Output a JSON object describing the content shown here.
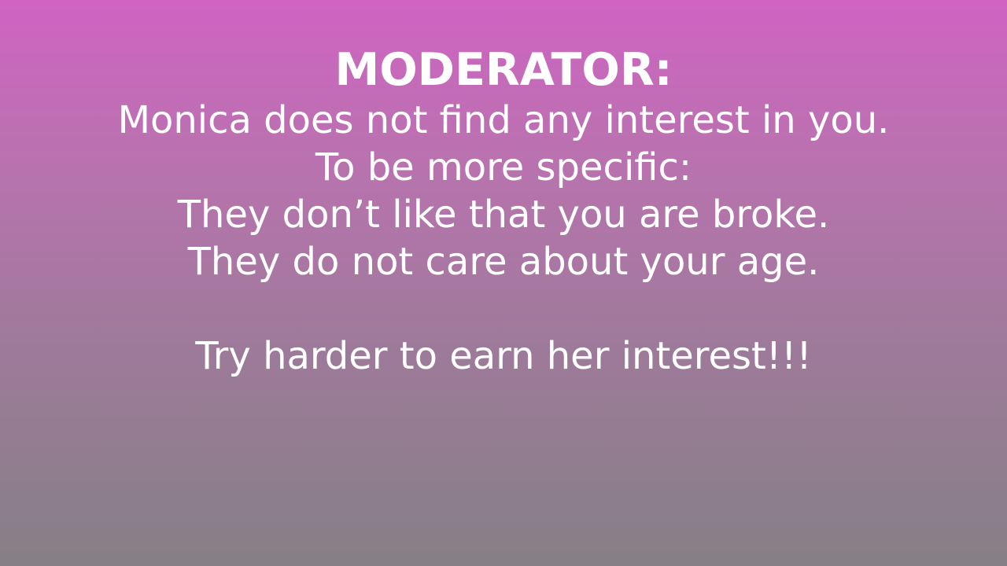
{
  "slide": {
    "title": "MODERATOR:",
    "lines": [
      "Monica does not find any interest in you.",
      "To be more specific:",
      "They don’t like that you are broke.",
      "They do not care about your age."
    ],
    "closing": "Try harder to earn her interest!!!"
  }
}
